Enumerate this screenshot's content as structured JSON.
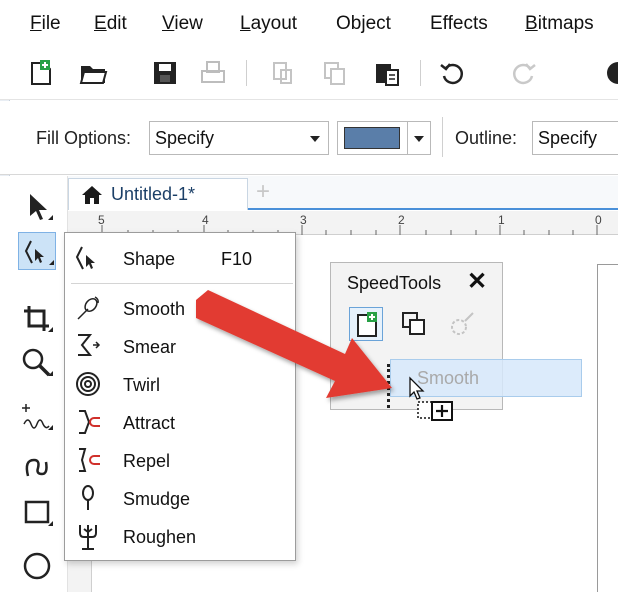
{
  "menubar": {
    "items": [
      {
        "label": "File",
        "key": "F",
        "rest": "ile"
      },
      {
        "label": "Edit",
        "key": "E",
        "rest": "dit"
      },
      {
        "label": "View",
        "key": "V",
        "rest": "iew"
      },
      {
        "label": "Layout",
        "key": "L",
        "rest": "ayout"
      },
      {
        "label": "Object",
        "key": "",
        "rest": "Object"
      },
      {
        "label": "Effects",
        "key": "",
        "rest": "Effects"
      },
      {
        "label": "Bitmaps",
        "key": "B",
        "rest": "itmaps"
      }
    ]
  },
  "toolbar": {
    "icons": [
      "new-document-icon",
      "open-icon",
      "save-icon",
      "print-icon",
      "cut-icon",
      "copy-icon",
      "paste-icon",
      "undo-icon",
      "redo-icon"
    ]
  },
  "property_bar": {
    "fill_label": "Fill Options:",
    "fill_value": "Specify",
    "fill_color": "#5a7ea9",
    "outline_label": "Outline:",
    "outline_value": "Specify"
  },
  "document": {
    "tab_title": "Untitled-1*",
    "new_tab": "+"
  },
  "ruler": {
    "numbers": [
      "5",
      "4",
      "3",
      "2",
      "1",
      "0"
    ]
  },
  "flyout": {
    "items": [
      {
        "label": "Shape",
        "shortcut": "F10",
        "icon": "shape-tool-icon"
      },
      {
        "label": "Smooth",
        "icon": "smooth-tool-icon"
      },
      {
        "label": "Smear",
        "icon": "smear-tool-icon"
      },
      {
        "label": "Twirl",
        "icon": "twirl-tool-icon"
      },
      {
        "label": "Attract",
        "icon": "attract-tool-icon"
      },
      {
        "label": "Repel",
        "icon": "repel-tool-icon"
      },
      {
        "label": "Smudge",
        "icon": "smudge-tool-icon"
      },
      {
        "label": "Roughen",
        "icon": "roughen-tool-icon"
      }
    ]
  },
  "speedtools": {
    "title": "SpeedTools",
    "close": "✕",
    "ghost_label": "Smooth"
  },
  "colors": {
    "accent": "#4a90d9",
    "arrow": "#e23b32"
  }
}
